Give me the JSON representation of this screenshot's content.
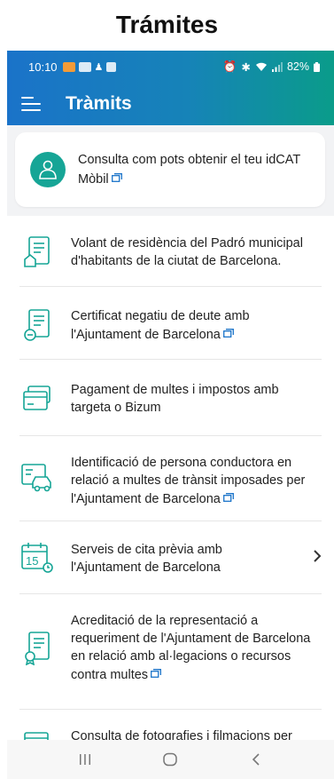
{
  "caption": "Trámites",
  "status_bar": {
    "time": "10:10",
    "battery": "82%"
  },
  "app_bar": {
    "title": "Tràmits"
  },
  "banner": {
    "text": "Consulta com pots obtenir el teu idCAT Mòbil"
  },
  "items": [
    {
      "label": "Volant de residència del Padró municipal d'habitants de la ciutat de Barcelona.",
      "external": false,
      "chevron": false
    },
    {
      "label": "Certificat negatiu de deute amb l'Ajuntament de Barcelona",
      "external": true,
      "chevron": false
    },
    {
      "label": "Pagament de multes i impostos amb targeta o Bizum",
      "external": false,
      "chevron": false
    },
    {
      "label": "Identificació de persona conductora en relació a multes de trànsit imposades per l'Ajuntament de Barcelona",
      "external": true,
      "chevron": false
    },
    {
      "label": "Serveis de cita prèvia amb l'Ajuntament de Barcelona",
      "external": false,
      "chevron": true
    },
    {
      "label": "Acreditació de la representació a requeriment de l'Ajuntament de Barcelona en relació amb al·legacions o recursos contra multes",
      "external": true,
      "chevron": false
    },
    {
      "label": "Consulta de fotografies i filmacions per infraccions de trànsit",
      "external": true,
      "chevron": false
    }
  ],
  "calendar_icon_day": "15",
  "colors": {
    "brand_blue": "#1a73c9",
    "brand_teal": "#0a9c8a",
    "icon_green": "#16a596"
  }
}
